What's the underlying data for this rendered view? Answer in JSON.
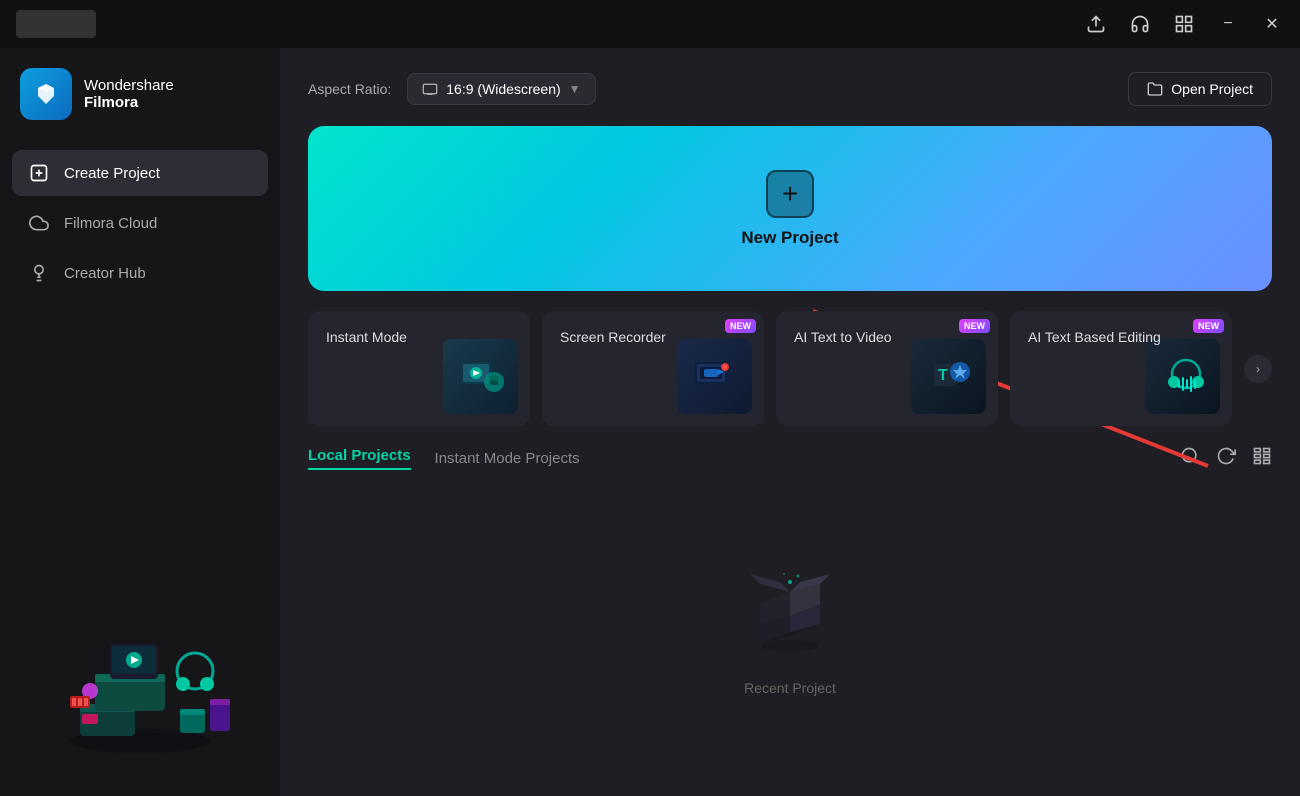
{
  "titlebar": {
    "upload_icon": "⬆",
    "headset_icon": "🎧",
    "grid_icon": "⊞",
    "minimize_label": "−",
    "close_label": "✕"
  },
  "sidebar": {
    "logo_line1": "Wondershare",
    "logo_line2": "Filmora",
    "nav_items": [
      {
        "id": "create-project",
        "label": "Create Project",
        "active": true
      },
      {
        "id": "filmora-cloud",
        "label": "Filmora Cloud",
        "active": false
      },
      {
        "id": "creator-hub",
        "label": "Creator Hub",
        "active": false
      }
    ]
  },
  "content": {
    "aspect_ratio_label": "Aspect Ratio:",
    "aspect_ratio_value": "16:9 (Widescreen)",
    "open_project_label": "Open Project",
    "new_project_label": "New Project",
    "feature_cards": [
      {
        "id": "instant-mode",
        "label": "Instant Mode",
        "badge": ""
      },
      {
        "id": "screen-recorder",
        "label": "Screen Recorder",
        "badge": "NEW"
      },
      {
        "id": "ai-text-to-video",
        "label": "AI Text to Video",
        "badge": "NEW"
      },
      {
        "id": "ai-text-editing",
        "label": "AI Text Based Editing",
        "badge": "NEW"
      }
    ],
    "tabs": [
      {
        "id": "local-projects",
        "label": "Local Projects",
        "active": true
      },
      {
        "id": "instant-mode-projects",
        "label": "Instant Mode Projects",
        "active": false
      }
    ],
    "empty_state_label": "Recent Project"
  }
}
